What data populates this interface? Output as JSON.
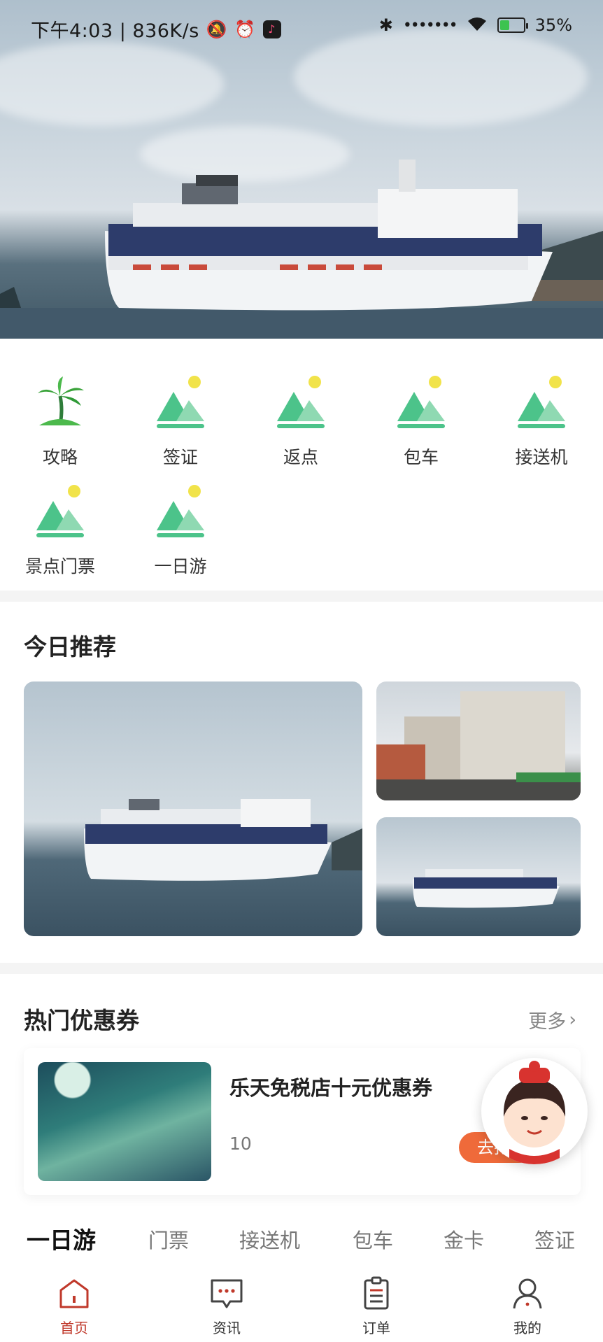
{
  "status_bar": {
    "time_speed": "下午4:03 | 836K/s",
    "signal_dots": "•••••••",
    "battery": "35%"
  },
  "quick_menu": {
    "items": [
      {
        "label": "攻略",
        "icon": "palm-tree-icon"
      },
      {
        "label": "签证",
        "icon": "landscape-icon"
      },
      {
        "label": "返点",
        "icon": "landscape-icon"
      },
      {
        "label": "包车",
        "icon": "landscape-icon"
      },
      {
        "label": "接送机",
        "icon": "landscape-icon"
      },
      {
        "label": "景点门票",
        "icon": "landscape-icon"
      },
      {
        "label": "一日游",
        "icon": "landscape-icon"
      }
    ]
  },
  "recommend": {
    "title": "今日推荐"
  },
  "coupons": {
    "title": "热门优惠券",
    "more_label": "更多",
    "card": {
      "title": "乐天免税店十元优惠券",
      "price": "10",
      "button_label": "去抢"
    }
  },
  "category_tabs": [
    "一日游",
    "门票",
    "接送机",
    "包车",
    "金卡",
    "签证"
  ],
  "bottom_nav": [
    {
      "label": "首页",
      "icon": "home-icon"
    },
    {
      "label": "资讯",
      "icon": "chat-icon"
    },
    {
      "label": "订单",
      "icon": "order-icon"
    },
    {
      "label": "我的",
      "icon": "user-icon"
    }
  ],
  "colors": {
    "accent_red": "#c0392b",
    "coupon_orange": "#ef6a3a",
    "icon_green": "#4cc38a",
    "icon_sun": "#f1e34a"
  }
}
